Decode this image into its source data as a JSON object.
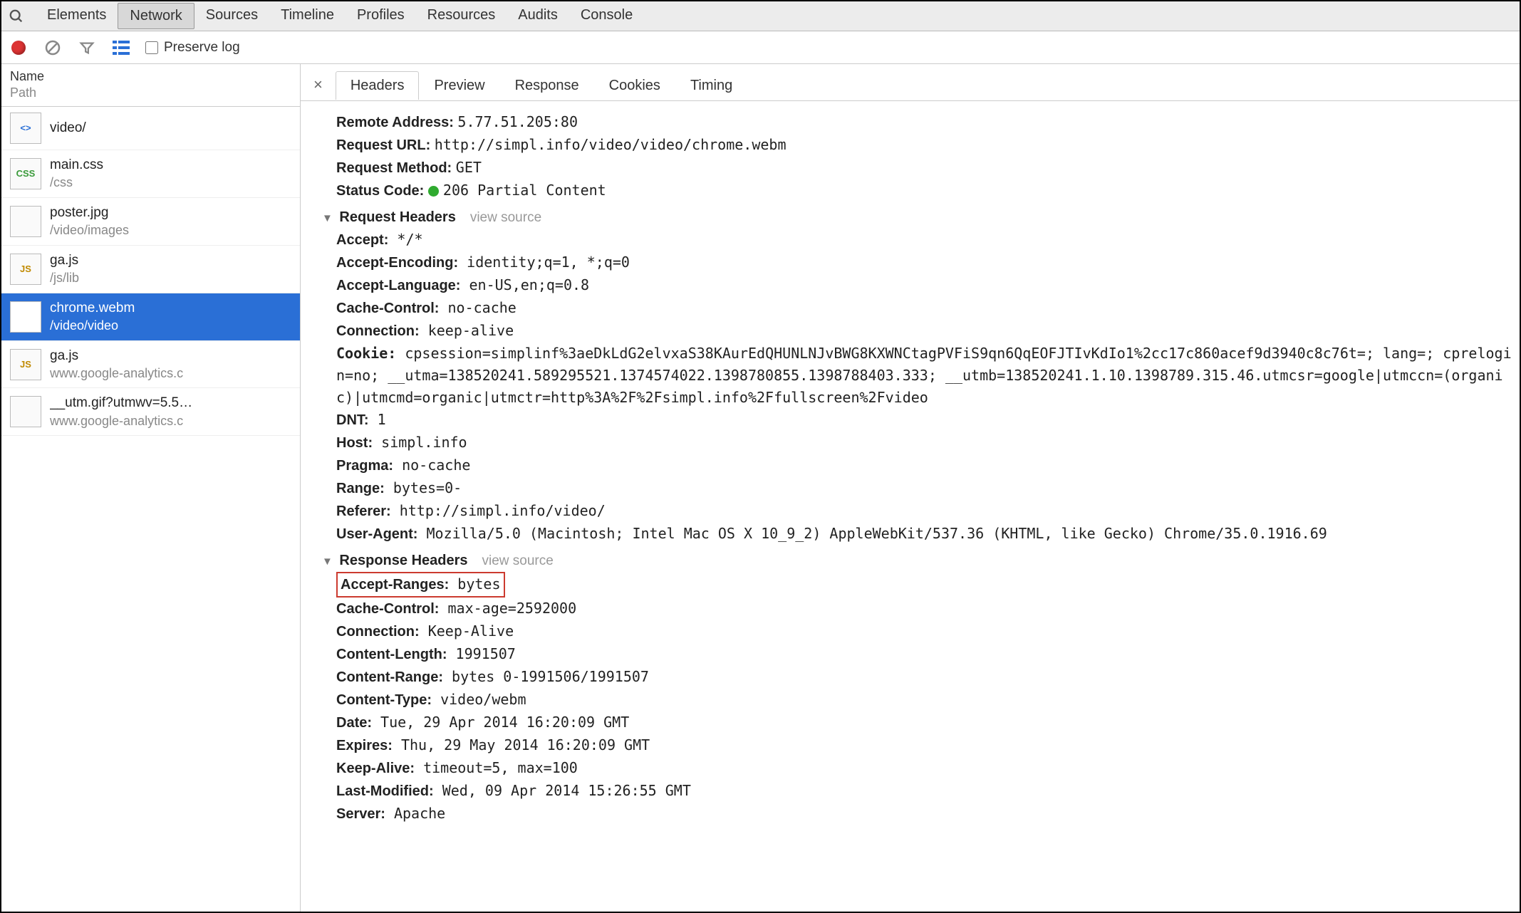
{
  "topTabs": [
    "Elements",
    "Network",
    "Sources",
    "Timeline",
    "Profiles",
    "Resources",
    "Audits",
    "Console"
  ],
  "topActive": "Network",
  "preserveLabel": "Preserve log",
  "sidebarHeader": {
    "name": "Name",
    "path": "Path"
  },
  "requests": [
    {
      "name": "video/",
      "path": "",
      "iconText": "<>",
      "iconClass": "ic-html"
    },
    {
      "name": "main.css",
      "path": "/css",
      "iconText": "CSS",
      "iconClass": "ic-css"
    },
    {
      "name": "poster.jpg",
      "path": "/video/images",
      "iconText": "",
      "iconClass": "ic-img"
    },
    {
      "name": "ga.js",
      "path": "/js/lib",
      "iconText": "JS",
      "iconClass": "ic-js"
    },
    {
      "name": "chrome.webm",
      "path": "/video/video",
      "iconText": "",
      "iconClass": "ic-doc",
      "selected": true
    },
    {
      "name": "ga.js",
      "path": "www.google-analytics.c",
      "iconText": "JS",
      "iconClass": "ic-js"
    },
    {
      "name": "__utm.gif?utmwv=5.5…",
      "path": "www.google-analytics.c",
      "iconText": "",
      "iconClass": "ic-doc"
    }
  ],
  "detailTabs": [
    "Headers",
    "Preview",
    "Response",
    "Cookies",
    "Timing"
  ],
  "detailActive": "Headers",
  "general": {
    "remoteAddressLabel": "Remote Address:",
    "remoteAddress": "5.77.51.205:80",
    "requestUrlLabel": "Request URL:",
    "requestUrl": "http://simpl.info/video/video/chrome.webm",
    "requestMethodLabel": "Request Method:",
    "requestMethod": "GET",
    "statusCodeLabel": "Status Code:",
    "statusCode": "206 Partial Content"
  },
  "requestHeadersTitle": "Request Headers",
  "viewSource": "view source",
  "requestHeaders": [
    {
      "k": "Accept:",
      "v": "*/*"
    },
    {
      "k": "Accept-Encoding:",
      "v": "identity;q=1, *;q=0"
    },
    {
      "k": "Accept-Language:",
      "v": "en-US,en;q=0.8"
    },
    {
      "k": "Cache-Control:",
      "v": "no-cache"
    },
    {
      "k": "Connection:",
      "v": "keep-alive"
    }
  ],
  "cookieLabel": "Cookie:",
  "cookieValue": "cpsession=simplinf%3aeDkLdG2elvxaS38KAurEdQHUNLNJvBWG8KXWNCtagPVFiS9qn6QqEOFJTIvKdIo1%2cc17c860acef9d3940c8c76t=; lang=; cprelogin=no; __utma=138520241.589295521.1374574022.1398780855.1398788403.333; __utmb=138520241.1.10.1398789.315.46.utmcsr=google|utmccn=(organic)|utmcmd=organic|utmctr=http%3A%2F%2Fsimpl.info%2Ffullscreen%2Fvideo",
  "requestHeaders2": [
    {
      "k": "DNT:",
      "v": "1"
    },
    {
      "k": "Host:",
      "v": "simpl.info"
    },
    {
      "k": "Pragma:",
      "v": "no-cache"
    },
    {
      "k": "Range:",
      "v": "bytes=0-"
    },
    {
      "k": "Referer:",
      "v": "http://simpl.info/video/"
    },
    {
      "k": "User-Agent:",
      "v": "Mozilla/5.0 (Macintosh; Intel Mac OS X 10_9_2) AppleWebKit/537.36 (KHTML, like Gecko) Chrome/35.0.1916.69"
    }
  ],
  "responseHeadersTitle": "Response Headers",
  "responseHeaders": [
    {
      "k": "Accept-Ranges:",
      "v": "bytes",
      "highlight": true
    },
    {
      "k": "Cache-Control:",
      "v": "max-age=2592000"
    },
    {
      "k": "Connection:",
      "v": "Keep-Alive"
    },
    {
      "k": "Content-Length:",
      "v": "1991507"
    },
    {
      "k": "Content-Range:",
      "v": "bytes 0-1991506/1991507"
    },
    {
      "k": "Content-Type:",
      "v": "video/webm"
    },
    {
      "k": "Date:",
      "v": "Tue, 29 Apr 2014 16:20:09 GMT"
    },
    {
      "k": "Expires:",
      "v": "Thu, 29 May 2014 16:20:09 GMT"
    },
    {
      "k": "Keep-Alive:",
      "v": "timeout=5, max=100"
    },
    {
      "k": "Last-Modified:",
      "v": "Wed, 09 Apr 2014 15:26:55 GMT"
    },
    {
      "k": "Server:",
      "v": "Apache"
    }
  ]
}
